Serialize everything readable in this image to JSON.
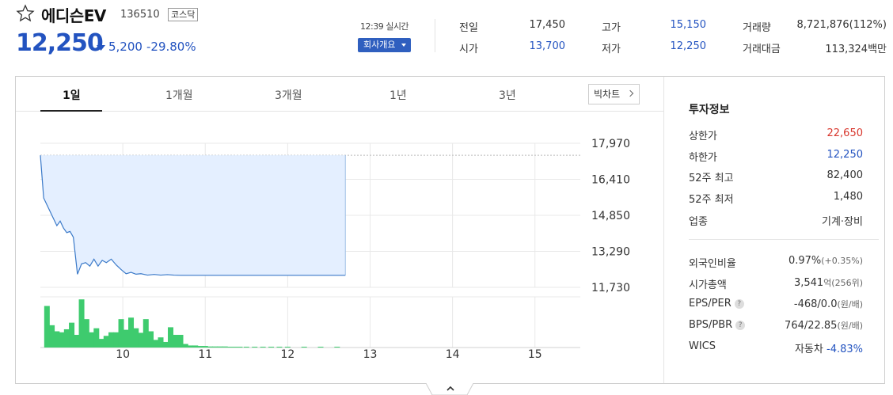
{
  "header": {
    "star_icon": "star-outline-icon",
    "name": "에디슨EV",
    "code": "136510",
    "market": "코스닥",
    "price": "12,250",
    "change_amount": "5,200",
    "change_percent": "-29.80%",
    "realtime_label": "12:39 실시간",
    "company_button": "회사개요"
  },
  "quote": {
    "prev_close_label": "전일",
    "prev_close": "17,450",
    "open_label": "시가",
    "open": "13,700",
    "high_label": "고가",
    "high": "15,150",
    "low_label": "저가",
    "low": "12,250",
    "volume_label": "거래량",
    "volume": "8,721,876(112%)",
    "amount_label": "거래대금",
    "amount": "113,324백만"
  },
  "tabs": [
    {
      "label": "1일",
      "active": true
    },
    {
      "label": "1개월",
      "active": false
    },
    {
      "label": "3개월",
      "active": false
    },
    {
      "label": "1년",
      "active": false
    },
    {
      "label": "3년",
      "active": false
    }
  ],
  "big_chart_label": "빅차트",
  "chart_data": {
    "type": "line",
    "y_ticks": [
      "17,970",
      "16,410",
      "14,850",
      "13,290",
      "11,730"
    ],
    "y_tick_values": [
      17970,
      16410,
      14850,
      13290,
      11730
    ],
    "x_ticks": [
      "10",
      "11",
      "12",
      "13",
      "14",
      "15"
    ],
    "x_tick_hours": [
      10,
      11,
      12,
      13,
      14,
      15
    ],
    "ylim": [
      11730,
      17970
    ],
    "xlim": [
      9.0,
      15.55
    ],
    "reference_price": 17450,
    "price_series": [
      [
        9.0,
        17450
      ],
      [
        9.04,
        15600
      ],
      [
        9.1,
        15150
      ],
      [
        9.16,
        14700
      ],
      [
        9.2,
        14400
      ],
      [
        9.24,
        14600
      ],
      [
        9.28,
        14300
      ],
      [
        9.32,
        14100
      ],
      [
        9.36,
        14150
      ],
      [
        9.4,
        13900
      ],
      [
        9.45,
        12300
      ],
      [
        9.5,
        12750
      ],
      [
        9.55,
        12800
      ],
      [
        9.6,
        12650
      ],
      [
        9.65,
        12950
      ],
      [
        9.7,
        12650
      ],
      [
        9.75,
        12900
      ],
      [
        9.8,
        12800
      ],
      [
        9.86,
        12950
      ],
      [
        9.92,
        12700
      ],
      [
        9.98,
        12500
      ],
      [
        10.04,
        12320
      ],
      [
        10.1,
        12380
      ],
      [
        10.16,
        12300
      ],
      [
        10.22,
        12320
      ],
      [
        10.3,
        12260
      ],
      [
        10.38,
        12290
      ],
      [
        10.46,
        12260
      ],
      [
        10.54,
        12280
      ],
      [
        10.62,
        12260
      ],
      [
        10.7,
        12250
      ],
      [
        11.0,
        12250
      ],
      [
        11.5,
        12250
      ],
      [
        12.0,
        12250
      ],
      [
        12.5,
        12250
      ],
      [
        12.7,
        12250
      ]
    ],
    "volume_series": [
      [
        9.08,
        0.82
      ],
      [
        9.14,
        0.44
      ],
      [
        9.2,
        0.32
      ],
      [
        9.26,
        0.3
      ],
      [
        9.32,
        0.36
      ],
      [
        9.38,
        0.49
      ],
      [
        9.44,
        0.25
      ],
      [
        9.5,
        0.95
      ],
      [
        9.56,
        0.56
      ],
      [
        9.62,
        0.3
      ],
      [
        9.68,
        0.38
      ],
      [
        9.74,
        0.17
      ],
      [
        9.8,
        0.23
      ],
      [
        9.86,
        0.3
      ],
      [
        9.92,
        0.3
      ],
      [
        9.98,
        0.56
      ],
      [
        10.04,
        0.35
      ],
      [
        10.1,
        0.59
      ],
      [
        10.16,
        0.38
      ],
      [
        10.22,
        0.29
      ],
      [
        10.28,
        0.56
      ],
      [
        10.34,
        0.32
      ],
      [
        10.4,
        0.15
      ],
      [
        10.46,
        0.2
      ],
      [
        10.52,
        0.11
      ],
      [
        10.58,
        0.4
      ],
      [
        10.64,
        0.25
      ],
      [
        10.7,
        0.25
      ],
      [
        10.76,
        0.07
      ],
      [
        10.82,
        0.04
      ],
      [
        10.88,
        0.04
      ],
      [
        10.94,
        0.03
      ],
      [
        11.0,
        0.03
      ],
      [
        11.06,
        0.02
      ],
      [
        11.12,
        0.02
      ],
      [
        11.18,
        0.02
      ],
      [
        11.24,
        0.02
      ],
      [
        11.3,
        0.01
      ],
      [
        11.36,
        0.01
      ],
      [
        11.42,
        0.01
      ],
      [
        11.5,
        0.01
      ],
      [
        11.6,
        0.01
      ],
      [
        11.7,
        0.01
      ],
      [
        11.8,
        0.01
      ],
      [
        11.9,
        0.01
      ],
      [
        12.0,
        0.01
      ],
      [
        12.2,
        0.01
      ],
      [
        12.4,
        0.01
      ],
      [
        12.6,
        0.01
      ]
    ],
    "colors": {
      "line": "#3b7ac9",
      "fill": "#e4efff",
      "volume": "#3ecb6e",
      "grid": "#e8e8e8",
      "ref": "#bbbbbb"
    }
  },
  "invest": {
    "title": "투자정보",
    "rows": [
      {
        "label": "상한가",
        "value": "22,650",
        "color": "red"
      },
      {
        "label": "하한가",
        "value": "12,250",
        "color": "blue"
      },
      {
        "label": "52주 최고",
        "value": "82,400"
      },
      {
        "label": "52주 최저",
        "value": "1,480"
      },
      {
        "label": "업종",
        "value": "기계·장비"
      }
    ],
    "rows2": [
      {
        "label": "외국인비율",
        "value": "0.97%",
        "sub": "(+0.35%)"
      },
      {
        "label": "시가총액",
        "value": "3,541",
        "sub": "억(256위)"
      },
      {
        "label": "EPS/PER",
        "help": "?",
        "value": "-468/0.0",
        "sub": "(원/배)"
      },
      {
        "label": "BPS/PBR",
        "help": "?",
        "value": "764/22.85",
        "sub": "(원/배)"
      },
      {
        "label": "WICS",
        "value": "자동차",
        "sub": "-4.83%"
      }
    ]
  }
}
